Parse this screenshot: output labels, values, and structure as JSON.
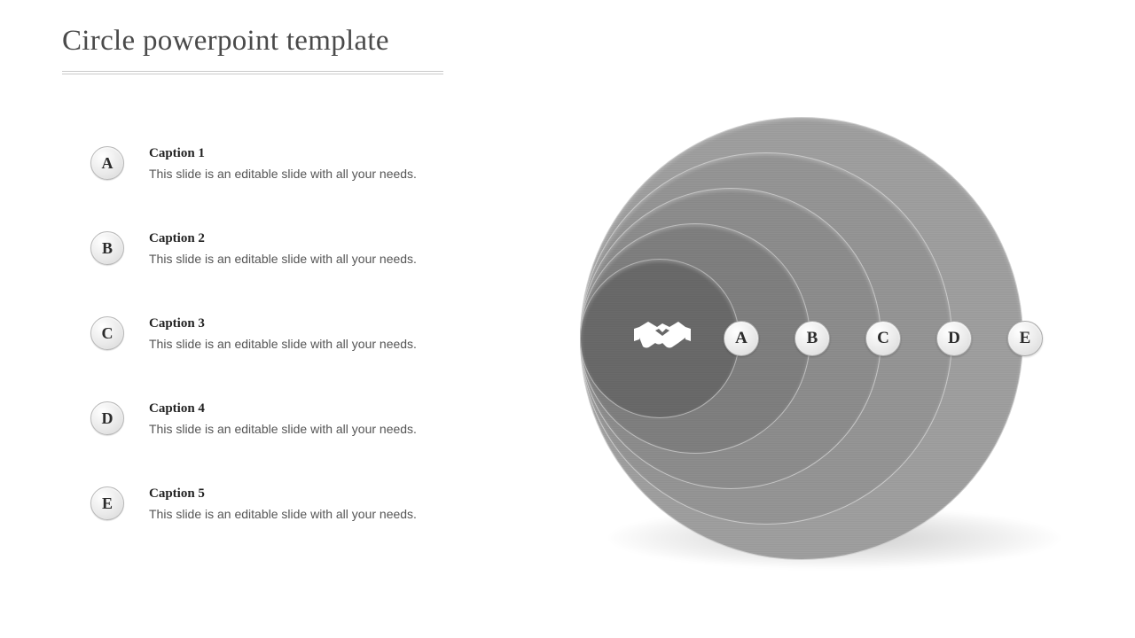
{
  "title": "Circle powerpoint template",
  "captions": [
    {
      "letter": "A",
      "title": "Caption 1",
      "body": "This slide is an editable slide with all your needs."
    },
    {
      "letter": "B",
      "title": "Caption 2",
      "body": "This slide is an editable slide with all your needs."
    },
    {
      "letter": "C",
      "title": "Caption 3",
      "body": "This slide is an editable slide with all your needs."
    },
    {
      "letter": "D",
      "title": "Caption 4",
      "body": "This slide is an editable slide with all your needs."
    },
    {
      "letter": "E",
      "title": "Caption 5",
      "body": "This slide is an editable slide with all your needs."
    }
  ],
  "diagram": {
    "icon": "handshake-icon",
    "letters": [
      "A",
      "B",
      "C",
      "D",
      "E"
    ],
    "colors": [
      "#6a6a6a",
      "#808080",
      "#8e8e8e",
      "#969696",
      "#a0a0a0"
    ]
  }
}
